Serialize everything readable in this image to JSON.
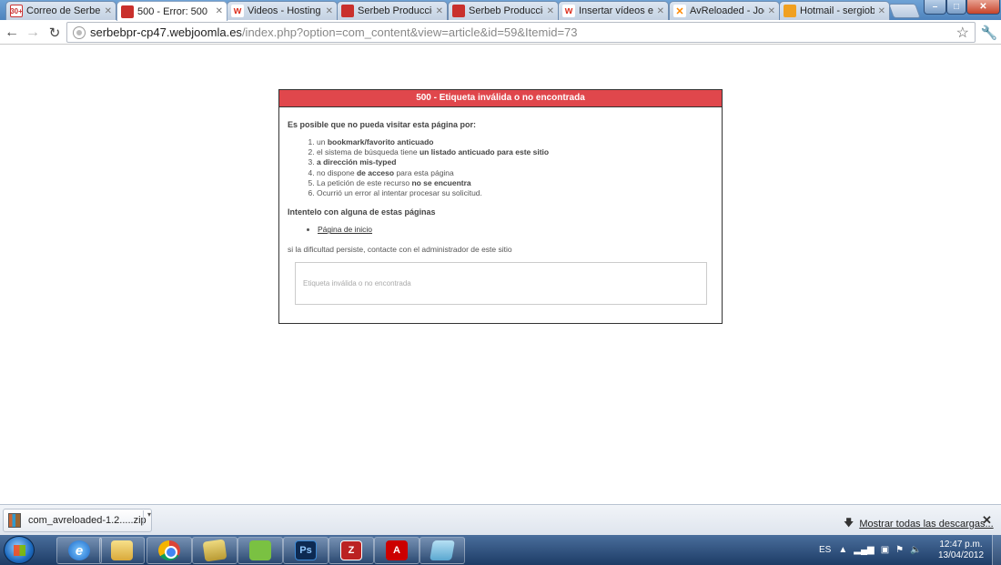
{
  "tabs": [
    {
      "title": "Correo de Serbebpr",
      "favicon": "gmail",
      "favicon_text": "30+",
      "active": false
    },
    {
      "title": "500 - Error: 500",
      "favicon": "joomla",
      "favicon_text": "",
      "active": true
    },
    {
      "title": "Videos - Hosting Jo",
      "favicon": "w",
      "favicon_text": "w",
      "active": false
    },
    {
      "title": "Serbeb Produccion",
      "favicon": "joomla",
      "favicon_text": "",
      "active": false
    },
    {
      "title": "Serbeb Produccion",
      "favicon": "joomla",
      "favicon_text": "",
      "active": false
    },
    {
      "title": "Insertar vídeos en a",
      "favicon": "w",
      "favicon_text": "w",
      "active": false
    },
    {
      "title": "AvReloaded - Joom",
      "favicon": "j",
      "favicon_text": "✕",
      "active": false
    },
    {
      "title": "Hotmail - sergiobc",
      "favicon": "hotmail",
      "favicon_text": "",
      "active": false
    }
  ],
  "toolbar": {
    "url_host": "serbebpr-cp47.webjoomla.es",
    "url_path": "/index.php?option=com_content&view=article&id=59&Itemid=73"
  },
  "error": {
    "title": "500 - Etiqueta inválida o no encontrada",
    "lead": "Es posible que no pueda visitar esta página por:",
    "reasons": [
      {
        "pre": "un ",
        "bold": "bookmark/favorito anticuado",
        "post": ""
      },
      {
        "pre": "el sistema de búsqueda tiene ",
        "bold": "un listado anticuado para este sitio",
        "post": ""
      },
      {
        "pre": "",
        "bold": "a dirección mis-typed",
        "post": ""
      },
      {
        "pre": "no dispone ",
        "bold": "de acceso",
        "post": " para esta página"
      },
      {
        "pre": "La petición de este recurso ",
        "bold": "no se encuentra",
        "post": ""
      },
      {
        "pre": "Ocurrió un error al intentar procesar su solicitud.",
        "bold": "",
        "post": ""
      }
    ],
    "try_lead": "Intentelo con alguna de estas páginas",
    "home_link": "Página de inicio",
    "persist": "si la dificultad persiste, contacte con el administrador de este sitio",
    "tech_message": "Etiqueta inválida o no encontrada"
  },
  "downloads": {
    "file_name": "com_avreloaded-1.2.....zip",
    "show_all": "Mostrar todas las descargas..."
  },
  "taskbar": {
    "apps": [
      "internet-explorer",
      "windows-explorer",
      "chrome",
      "folder",
      "evernote",
      "photoshop",
      "filezilla",
      "acrobat-reader",
      "windows-app"
    ],
    "ps_label": "Ps",
    "language": "ES",
    "time": "12:47 p.m.",
    "date": "13/04/2012"
  }
}
